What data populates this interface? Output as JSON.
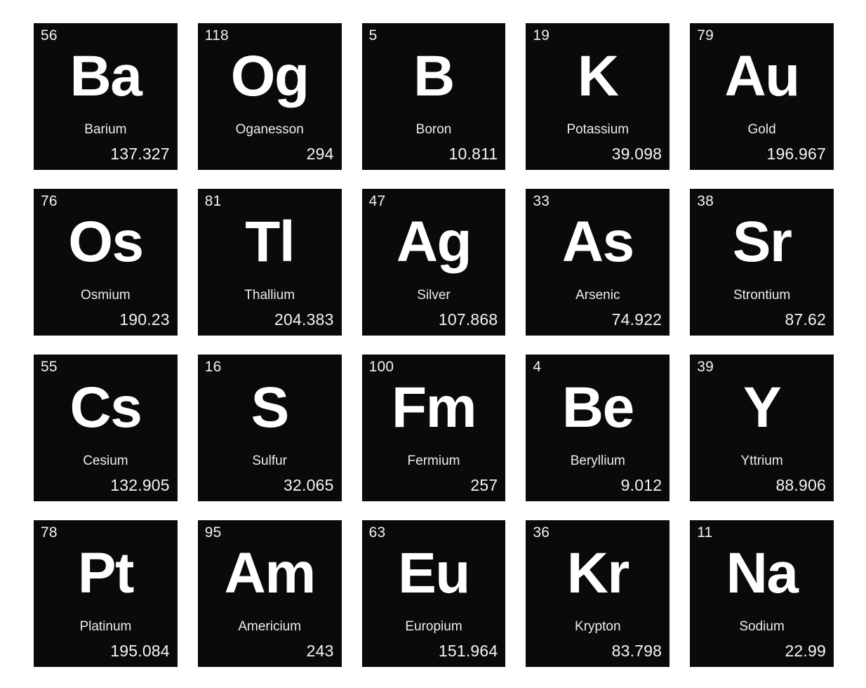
{
  "page": {
    "title": "Preview 20 Periodic Table Elements Pack",
    "background_color": "#ffffff",
    "tile_color": "#0a0a0a",
    "text_color": "#ffffff",
    "columns": 5,
    "rows": 4
  },
  "elements": [
    {
      "atomic_number": "56",
      "symbol": "Ba",
      "name": "Barium",
      "atomic_mass": "137.327"
    },
    {
      "atomic_number": "118",
      "symbol": "Og",
      "name": "Oganesson",
      "atomic_mass": "294"
    },
    {
      "atomic_number": "5",
      "symbol": "B",
      "name": "Boron",
      "atomic_mass": "10.811"
    },
    {
      "atomic_number": "19",
      "symbol": "K",
      "name": "Potassium",
      "atomic_mass": "39.098"
    },
    {
      "atomic_number": "79",
      "symbol": "Au",
      "name": "Gold",
      "atomic_mass": "196.967"
    },
    {
      "atomic_number": "76",
      "symbol": "Os",
      "name": "Osmium",
      "atomic_mass": "190.23"
    },
    {
      "atomic_number": "81",
      "symbol": "Tl",
      "name": "Thallium",
      "atomic_mass": "204.383"
    },
    {
      "atomic_number": "47",
      "symbol": "Ag",
      "name": "Silver",
      "atomic_mass": "107.868"
    },
    {
      "atomic_number": "33",
      "symbol": "As",
      "name": "Arsenic",
      "atomic_mass": "74.922"
    },
    {
      "atomic_number": "38",
      "symbol": "Sr",
      "name": "Strontium",
      "atomic_mass": "87.62"
    },
    {
      "atomic_number": "55",
      "symbol": "Cs",
      "name": "Cesium",
      "atomic_mass": "132.905"
    },
    {
      "atomic_number": "16",
      "symbol": "S",
      "name": "Sulfur",
      "atomic_mass": "32.065"
    },
    {
      "atomic_number": "100",
      "symbol": "Fm",
      "name": "Fermium",
      "atomic_mass": "257"
    },
    {
      "atomic_number": "4",
      "symbol": "Be",
      "name": "Beryllium",
      "atomic_mass": "9.012"
    },
    {
      "atomic_number": "39",
      "symbol": "Y",
      "name": "Yttrium",
      "atomic_mass": "88.906"
    },
    {
      "atomic_number": "78",
      "symbol": "Pt",
      "name": "Platinum",
      "atomic_mass": "195.084"
    },
    {
      "atomic_number": "95",
      "symbol": "Am",
      "name": "Americium",
      "atomic_mass": "243"
    },
    {
      "atomic_number": "63",
      "symbol": "Eu",
      "name": "Europium",
      "atomic_mass": "151.964"
    },
    {
      "atomic_number": "36",
      "symbol": "Kr",
      "name": "Krypton",
      "atomic_mass": "83.798"
    },
    {
      "atomic_number": "11",
      "symbol": "Na",
      "name": "Sodium",
      "atomic_mass": "22.99"
    }
  ]
}
